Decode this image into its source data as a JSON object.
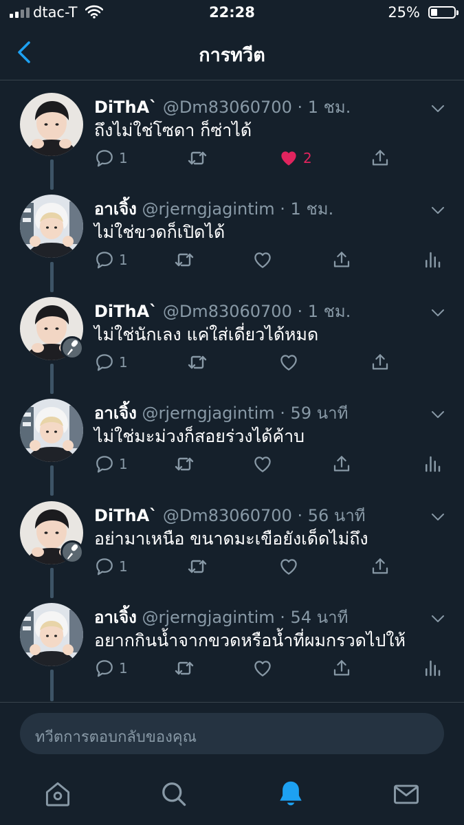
{
  "status_bar": {
    "carrier": "dtac-T",
    "time": "22:28",
    "battery": "25%"
  },
  "header": {
    "title": "การทวีต"
  },
  "colors": {
    "background": "#15202b",
    "accent": "#1da1f2",
    "like": "#e0245e",
    "muted": "#8899a6"
  },
  "tweets": [
    {
      "name": "DiThA`",
      "handle": "@Dm83060700",
      "time": "· 1 ชม.",
      "text": "ถึงไม่ใช่โซดา ก็ซ่าได้",
      "replies": "1",
      "likes": "2",
      "liked": true,
      "author": "dm"
    },
    {
      "name": "อาเจิ้ง",
      "handle": "@rjerngjagintim",
      "time": "· 1 ชม.",
      "text": "ไม่ใช่ขวดก็เปิดได้",
      "replies": "1",
      "likes": "",
      "liked": false,
      "author": "rj"
    },
    {
      "name": "DiThA`",
      "handle": "@Dm83060700",
      "time": "· 1 ชม.",
      "text": "ไม่ใช่นักเลง แค่ใส่เดี่ยวได้หมด",
      "replies": "1",
      "likes": "",
      "liked": false,
      "author": "dm"
    },
    {
      "name": "อาเจิ้ง",
      "handle": "@rjerngjagintim",
      "time": "· 59 นาที",
      "text": "ไม่ใช่มะม่วงก็สอยร่วงได้ค้าบ",
      "replies": "1",
      "likes": "",
      "liked": false,
      "author": "rj"
    },
    {
      "name": "DiThA`",
      "handle": "@Dm83060700",
      "time": "· 56 นาที",
      "text": "อย่ามาเหนือ ขนาดมะเขือยังเด็ดไม่ถึง",
      "replies": "1",
      "likes": "",
      "liked": false,
      "author": "dm"
    },
    {
      "name": "อาเจิ้ง",
      "handle": "@rjerngjagintim",
      "time": "· 54 นาที",
      "text": "อยากกินน้ำจากขวดหรือน้ำที่ผมกรวดไปให้",
      "replies": "1",
      "likes": "",
      "liked": false,
      "author": "rj"
    }
  ],
  "reply": {
    "placeholder": "ทวีตการตอบกลับของคุณ"
  },
  "tabs": [
    "home-icon",
    "search-icon",
    "bell-icon",
    "mail-icon"
  ]
}
